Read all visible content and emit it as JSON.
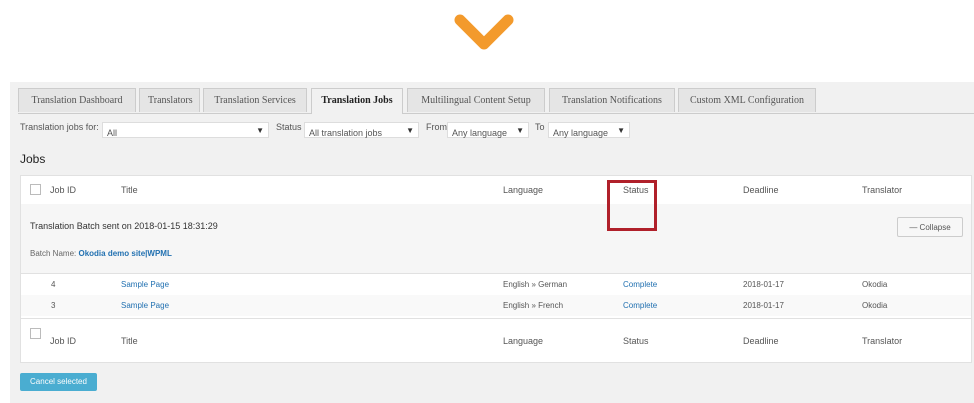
{
  "tabs": [
    {
      "label": "Translation Dashboard",
      "active": false
    },
    {
      "label": "Translators",
      "active": false
    },
    {
      "label": "Translation Services",
      "active": false
    },
    {
      "label": "Translation Jobs",
      "active": true
    },
    {
      "label": "Multilingual Content Setup",
      "active": false
    },
    {
      "label": "Translation Notifications",
      "active": false
    },
    {
      "label": "Custom XML Configuration",
      "active": false
    }
  ],
  "filters": {
    "jobs_for_label": "Translation jobs for:",
    "jobs_for_value": "All",
    "status_label": "Status",
    "status_value": "All translation jobs",
    "from_label": "From",
    "from_value": "Any language",
    "to_label": "To",
    "to_value": "Any language"
  },
  "section_title": "Jobs",
  "columns": {
    "job_id": "Job ID",
    "title": "Title",
    "language": "Language",
    "status": "Status",
    "deadline": "Deadline",
    "translator": "Translator"
  },
  "batch": {
    "title": "Translation Batch sent on 2018-01-15 18:31:29",
    "name_label": "Batch Name:",
    "name_value": "Okodia demo site|WPML",
    "collapse_label": "Collapse"
  },
  "jobs": [
    {
      "id": "4",
      "title": "Sample Page",
      "language": "English » German",
      "status": "Complete",
      "deadline": "2018-01-17",
      "translator": "Okodia"
    },
    {
      "id": "3",
      "title": "Sample Page",
      "language": "English » French",
      "status": "Complete",
      "deadline": "2018-01-17",
      "translator": "Okodia"
    }
  ],
  "cancel_label": "Cancel selected",
  "colors": {
    "accent_arrow": "#f39a2c",
    "highlight": "#b0202a",
    "link": "#2271b1",
    "button": "#2ea2cc"
  }
}
